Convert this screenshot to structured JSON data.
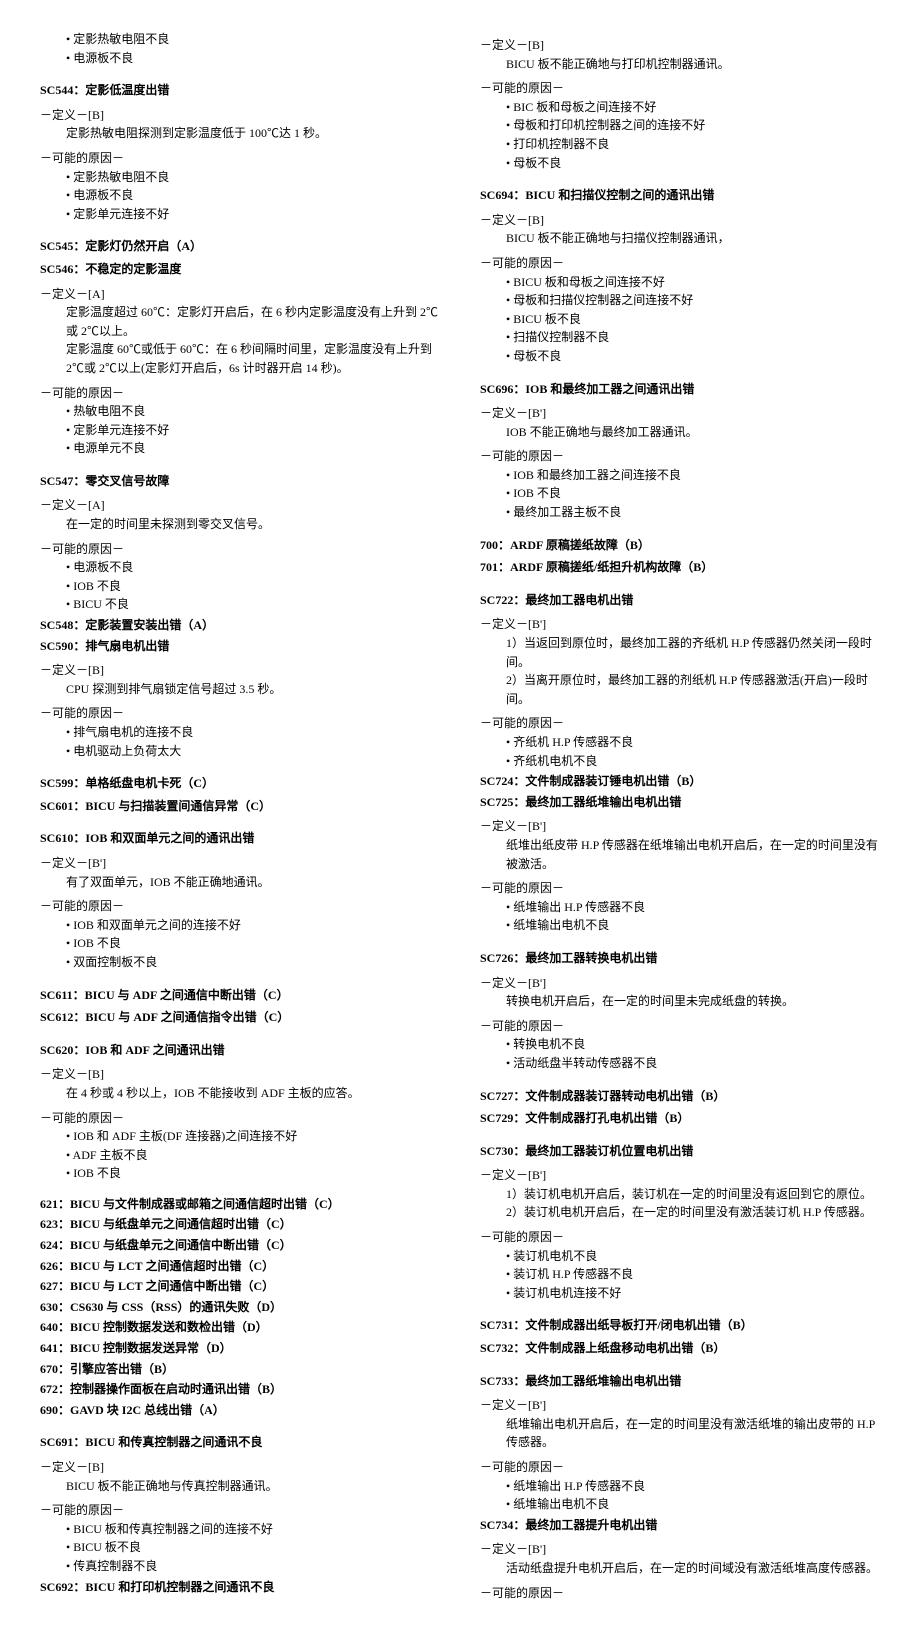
{
  "left": {
    "b1_bullets": [
      "定影热敏电阻不良",
      "电源板不良"
    ],
    "sc544_title": "SC544：定影低温度出错",
    "sc544_def_label": "－定义－[B]",
    "sc544_def": "定影热敏电阻探测到定影温度低于 100℃达 1 秒。",
    "sc544_cause_label": "－可能的原因－",
    "sc544_causes": [
      "定影热敏电阻不良",
      "电源板不良",
      "定影单元连接不好"
    ],
    "sc545_title": "SC545：定影灯仍然开启（A）",
    "sc546_title": "SC546：不稳定的定影温度",
    "sc545_def_label": "－定义－[A]",
    "sc545_def1": "定影温度超过 60℃：定影灯开启后，在 6 秒内定影温度没有上升到 2℃或 2℃以上。",
    "sc545_def2": "定影温度 60℃或低于 60℃：在 6 秒间隔时间里，定影温度没有上升到 2℃或 2℃以上(定影灯开启后，6s 计时器开启 14 秒)。",
    "sc545_cause_label": "－可能的原因－",
    "sc545_causes": [
      "热敏电阻不良",
      "定影单元连接不好",
      "电源单元不良"
    ],
    "sc547_title": "SC547：零交叉信号故障",
    "sc547_def_label": "－定义－[A]",
    "sc547_def": "在一定的时间里未探测到零交叉信号。",
    "sc547_cause_label": "－可能的原因－",
    "sc547_causes": [
      "电源板不良",
      "IOB 不良",
      "BICU 不良"
    ],
    "sc548_title": "SC548：定影装置安装出错（A）",
    "sc590_title": "SC590：排气扇电机出错",
    "sc590_def_label": "－定义－[B]",
    "sc590_def": "CPU 探测到排气扇锁定信号超过 3.5 秒。",
    "sc590_cause_label": "－可能的原因－",
    "sc590_causes": [
      "排气扇电机的连接不良",
      "电机驱动上负荷太大"
    ],
    "sc599_title": "SC599：单格纸盘电机卡死（C）",
    "sc601_title": "SC601：BICU 与扫描装置间通信异常（C）",
    "sc610_title": "SC610：IOB 和双面单元之间的通讯出错",
    "sc610_def_label": "－定义－[B']",
    "sc610_def": "有了双面单元，IOB 不能正确地通讯。",
    "sc610_cause_label": "－可能的原因－",
    "sc610_causes": [
      "IOB 和双面单元之间的连接不好",
      "IOB 不良",
      "双面控制板不良"
    ],
    "sc611_title": "SC611：BICU 与 ADF 之间通信中断出错（C）",
    "sc612_title": "SC612：BICU 与 ADF 之间通信指令出错（C）",
    "sc620_title": "SC620：IOB 和 ADF 之间通讯出错",
    "sc620_def_label": "－定义－[B]",
    "sc620_def": "在 4 秒或 4 秒以上，IOB 不能接收到 ADF 主板的应答。",
    "sc620_cause_label": "－可能的原因－",
    "sc620_causes": [
      "IOB 和 ADF 主板(DF 连接器)之间连接不好",
      "ADF 主板不良",
      "IOB 不良"
    ],
    "code_list": [
      "621：BICU 与文件制成器或邮箱之间通信超时出错（C）",
      "623：BICU 与纸盘单元之间通信超时出错（C）",
      "624：BICU 与纸盘单元之间通信中断出错（C）",
      "626：BICU 与 LCT 之间通信超时出错（C）",
      "627：BICU 与 LCT 之间通信中断出错（C）",
      "630：CS630 与 CSS（RSS）的通讯失败（D）",
      "640：BICU 控制数据发送和数检出错（D）",
      "641：BICU 控制数据发送异常（D）",
      "670：引擎应答出错（B）",
      "672：控制器操作面板在启动时通讯出错（B）",
      "690：GAVD 块 I2C 总线出错（A）"
    ],
    "sc691_title": "SC691：BICU 和传真控制器之间通讯不良",
    "sc691_def_label": "－定义－[B]",
    "sc691_def": "BICU 板不能正确地与传真控制器通讯。",
    "sc691_cause_label": "－可能的原因－",
    "sc691_causes": [
      "BICU 板和传真控制器之间的连接不好",
      "BICU 板不良",
      "传真控制器不良"
    ],
    "sc692_title": "SC692：BICU 和打印机控制器之间通讯不良"
  },
  "right": {
    "sc692_def_label": "－定义－[B]",
    "sc692_def": "BICU 板不能正确地与打印机控制器通讯。",
    "sc692_cause_label": "－可能的原因－",
    "sc692_causes": [
      "BIC 板和母板之间连接不好",
      "母板和打印机控制器之间的连接不好",
      "打印机控制器不良",
      "母板不良"
    ],
    "sc694_title": "SC694：BICU 和扫描仪控制之间的通讯出错",
    "sc694_def_label": "－定义－[B]",
    "sc694_def": "BICU 板不能正确地与扫描仪控制器通讯，",
    "sc694_cause_label": "－可能的原因－",
    "sc694_causes": [
      "BICU 板和母板之间连接不好",
      "母板和扫描仪控制器之间连接不好",
      "BICU 板不良",
      "扫描仪控制器不良",
      "母板不良"
    ],
    "sc696_title": "SC696：IOB 和最终加工器之间通讯出错",
    "sc696_def_label": "－定义－[B']",
    "sc696_def": "IOB 不能正确地与最终加工器通讯。",
    "sc696_cause_label": "－可能的原因－",
    "sc696_causes": [
      "IOB 和最终加工器之间连接不良",
      "IOB 不良",
      "最终加工器主板不良"
    ],
    "sc700_title": "700：ARDF 原稿搓纸故障（B）",
    "sc701_title": "701：ARDF 原稿搓纸/纸担升机构故障（B）",
    "sc722_title": "SC722：最终加工器电机出错",
    "sc722_def_label": "－定义－[B']",
    "sc722_def1": "1）当返回到原位时，最终加工器的齐纸机 H.P 传感器仍然关闭一段时间。",
    "sc722_def2": "2）当离开原位时，最终加工器的剂纸机 H.P 传感器激活(开启)一段时间。",
    "sc722_cause_label": "－可能的原因－",
    "sc722_causes": [
      "齐纸机 H.P 传感器不良",
      "齐纸机电机不良"
    ],
    "sc724_title": "SC724：文件制成器装订锤电机出错（B）",
    "sc725_title": "SC725：最终加工器纸堆输出电机出错",
    "sc725_def_label": "－定义－[B']",
    "sc725_def": "纸堆出纸皮带 H.P 传感器在纸堆输出电机开启后，在一定的时间里没有被激活。",
    "sc725_cause_label": "－可能的原因－",
    "sc725_causes": [
      "纸堆输出 H.P 传感器不良",
      "纸堆输出电机不良"
    ],
    "sc726_title": "SC726：最终加工器转换电机出错",
    "sc726_def_label": "－定义－[B']",
    "sc726_def": "转换电机开启后，在一定的时间里未完成纸盘的转换。",
    "sc726_cause_label": "－可能的原因－",
    "sc726_causes": [
      "转换电机不良",
      "活动纸盘半转动传感器不良"
    ],
    "sc727_title": "SC727：文件制成器装订器转动电机出错（B）",
    "sc729_title": "SC729：文件制成器打孔电机出错（B）",
    "sc730_title": "SC730：最终加工器装订机位置电机出错",
    "sc730_def_label": "－定义－[B']",
    "sc730_def1": "1）装订机电机开启后，装订机在一定的时间里没有返回到它的原位。",
    "sc730_def2": "2）装订机电机开启后，在一定的时间里没有激活装订机 H.P 传感器。",
    "sc730_cause_label": "－可能的原因－",
    "sc730_causes": [
      "装订机电机不良",
      "装订机 H.P 传感器不良",
      "装订机电机连接不好"
    ],
    "sc731_title": "SC731：文件制成器出纸导板打开/闭电机出错（B）",
    "sc732_title": "SC732：文件制成器上纸盘移动电机出错（B）",
    "sc733_title": "SC733：最终加工器纸堆输出电机出错",
    "sc733_def_label": "－定义－[B']",
    "sc733_def": "纸堆输出电机开启后，在一定的时间里没有激活纸堆的输出皮带的 H.P 传感器。",
    "sc733_cause_label": "－可能的原因－",
    "sc733_causes": [
      "纸堆输出 H.P 传感器不良",
      "纸堆输出电机不良"
    ],
    "sc734_title": "SC734：最终加工器提升电机出错",
    "sc734_def_label": "－定义－[B']",
    "sc734_def": "活动纸盘提升电机开启后，在一定的时间域没有激活纸堆高度传感器。",
    "sc734_cause_label": "－可能的原因－"
  }
}
